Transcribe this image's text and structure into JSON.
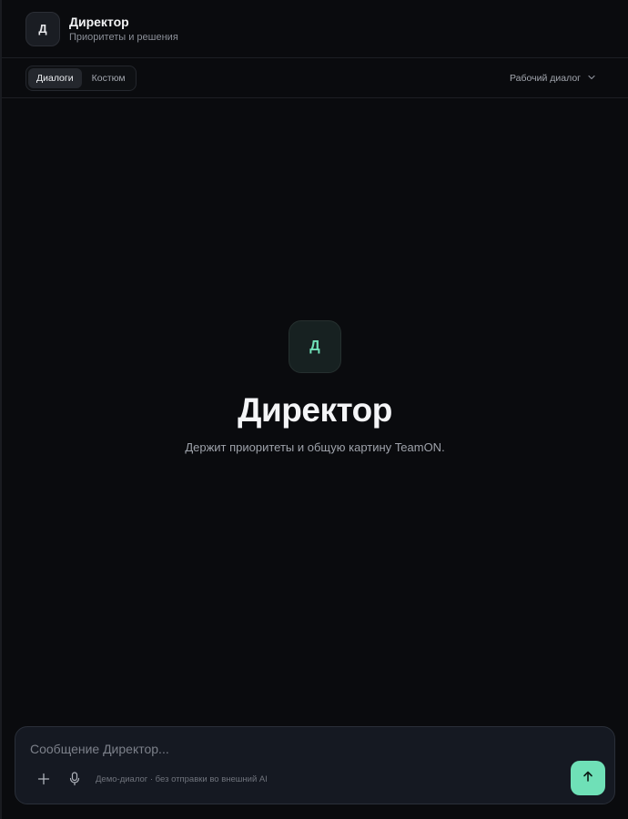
{
  "header": {
    "avatar_letter": "Д",
    "title": "Директор",
    "subtitle": "Приоритеты и решения"
  },
  "toolbar": {
    "tabs": [
      {
        "label": "Диалоги",
        "active": true
      },
      {
        "label": "Костюм",
        "active": false
      }
    ],
    "mode_select": {
      "label": "Рабочий диалог",
      "icon": "chevron-down-icon"
    }
  },
  "hero": {
    "avatar_letter": "Д",
    "title": "Директор",
    "subtitle": "Держит приоритеты и общую картину TeamON."
  },
  "composer": {
    "placeholder": "Сообщение Директор...",
    "value": "",
    "hint": "Демо-диалог · без отправки во внешний AI",
    "icons": [
      "plus-icon",
      "microphone-icon",
      "arrow-up-icon"
    ]
  },
  "colors": {
    "background": "#0a0b0e",
    "accent": "#6fe0b7",
    "panel": "#151922"
  }
}
